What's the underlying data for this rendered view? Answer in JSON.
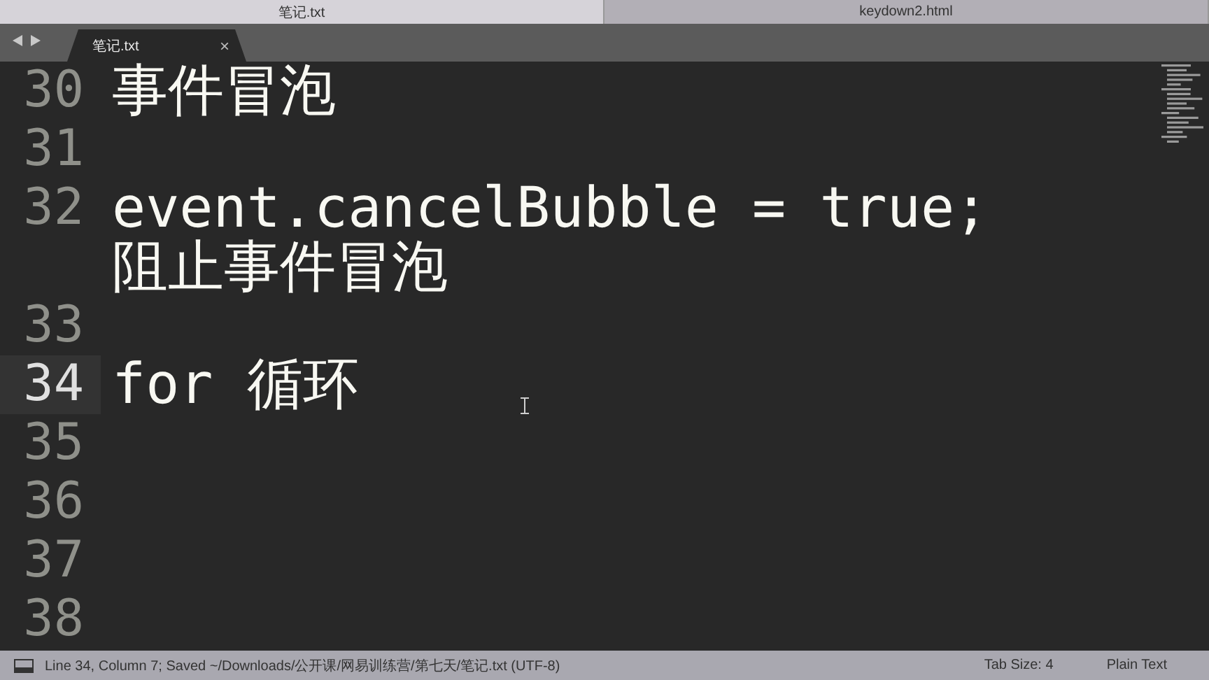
{
  "window_tabs": [
    {
      "label": "笔记.txt",
      "selected": true
    },
    {
      "label": "keydown2.html",
      "selected": false
    }
  ],
  "editor_tab": {
    "label": "笔记.txt",
    "close": "×"
  },
  "lines": [
    {
      "number": "30",
      "rows": [
        "事件冒泡"
      ],
      "current": false
    },
    {
      "number": "31",
      "current": false
    },
    {
      "number": "32",
      "rows": [
        "event.cancelBubble = true;",
        "阻止事件冒泡"
      ],
      "current": false
    },
    {
      "number": "33",
      "current": false
    },
    {
      "number": "34",
      "rows": [
        "for 循环"
      ],
      "current": true
    },
    {
      "number": "35",
      "current": false
    },
    {
      "number": "36",
      "current": false
    },
    {
      "number": "37",
      "current": false
    },
    {
      "number": "38",
      "current": false
    }
  ],
  "status_bar": {
    "position": "Line 34, Column 7; Saved ~/Downloads/公开课/网易训练营/第七天/笔记.txt (UTF-8)",
    "tab_size": "Tab Size: 4",
    "syntax": "Plain Text"
  }
}
